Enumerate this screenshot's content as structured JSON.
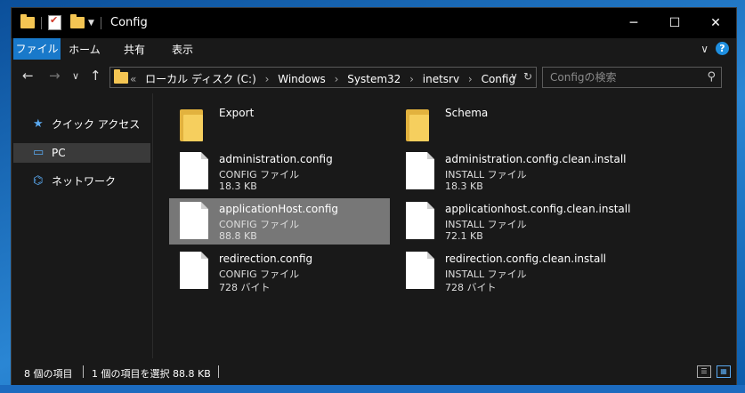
{
  "window": {
    "title": "Config",
    "controls": {
      "minimize": "─",
      "maximize": "☐",
      "close": "✕"
    }
  },
  "ribbon": {
    "tabs": [
      "ファイル",
      "ホーム",
      "共有",
      "表示"
    ],
    "expand_icon": "∨",
    "help_icon": "?"
  },
  "navigation": {
    "back": "←",
    "forward": "→",
    "recent": "∨",
    "up": "↑",
    "overflow": "«",
    "breadcrumbs": [
      "ローカル ディスク (C:)",
      "Windows",
      "System32",
      "inetsrv",
      "Config"
    ],
    "search_placeholder": "Configの検索"
  },
  "nav_pane": {
    "items": [
      {
        "label": "クイック アクセス",
        "icon": "star-icon"
      },
      {
        "label": "PC",
        "icon": "computer-icon",
        "selected": true
      },
      {
        "label": "ネットワーク",
        "icon": "network-icon"
      }
    ]
  },
  "files": [
    {
      "name": "Export",
      "kind": "folder",
      "type": "",
      "size": ""
    },
    {
      "name": "Schema",
      "kind": "folder",
      "type": "",
      "size": ""
    },
    {
      "name": "administration.config",
      "kind": "file",
      "type": "CONFIG ファイル",
      "size": "18.3 KB"
    },
    {
      "name": "administration.config.clean.install",
      "kind": "file",
      "type": "INSTALL ファイル",
      "size": "18.3 KB"
    },
    {
      "name": "applicationHost.config",
      "kind": "file",
      "type": "CONFIG ファイル",
      "size": "88.8 KB",
      "selected": true
    },
    {
      "name": "applicationhost.config.clean.install",
      "kind": "file",
      "type": "INSTALL ファイル",
      "size": "72.1 KB"
    },
    {
      "name": "redirection.config",
      "kind": "file",
      "type": "CONFIG ファイル",
      "size": "728 バイト"
    },
    {
      "name": "redirection.config.clean.install",
      "kind": "file",
      "type": "INSTALL ファイル",
      "size": "728 バイト"
    }
  ],
  "status": {
    "item_count": "8 個の項目",
    "selection": "1 個の項目を選択  88.8 KB"
  }
}
